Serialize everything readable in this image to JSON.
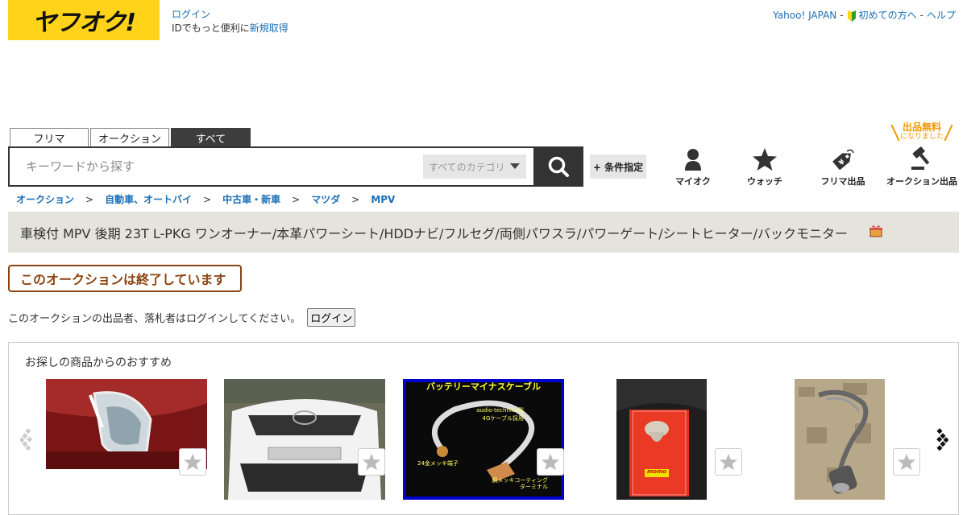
{
  "header": {
    "logo_text": "ヤフオク!",
    "login_label": "ログイン",
    "id_text": "IDでもっと便利に",
    "register_label": "新規取得",
    "yahoo_japan_label": "Yahoo! JAPAN",
    "first_time_label": "初めての方へ",
    "help_label": "ヘルプ",
    "separator": "-"
  },
  "search": {
    "tabs": [
      {
        "label": "フリマ"
      },
      {
        "label": "オークション"
      },
      {
        "label": "すべて"
      }
    ],
    "placeholder": "キーワードから探す",
    "category_label": "すべてのカテゴリ",
    "condition_label": "+ 条件指定"
  },
  "shortcuts": [
    {
      "label": "マイオク",
      "icon": "person-icon"
    },
    {
      "label": "ウォッチ",
      "icon": "star-icon"
    },
    {
      "label": "フリマ出品",
      "icon": "price-tag-icon"
    },
    {
      "label": "オークション出品",
      "icon": "gavel-icon"
    }
  ],
  "free_badge": {
    "main": "出品無料",
    "sub": "になりました"
  },
  "breadcrumb": [
    "オークション",
    "自動車、オートバイ",
    "中古車・新車",
    "マツダ",
    "MPV"
  ],
  "breadcrumb_sep": ">",
  "item": {
    "title": "車検付 MPV 後期 23T L-PKG ワンオーナー/本革パワーシート/HDDナビ/フルセグ/両側パワスラ/パワーゲート/シートヒーター/バックモニター"
  },
  "status": {
    "ended_label": "このオークションは終了しています",
    "login_message": "このオークションの出品者、落札者はログインしてください。",
    "login_button": "ログイン"
  },
  "recommend": {
    "heading": "お探しの商品からのおすすめ",
    "items": [
      {
        "name": "red-car-foglight-thumbnail"
      },
      {
        "name": "white-mpv-front-thumbnail"
      },
      {
        "name": "battery-cable-thumbnail",
        "caption": "バッテリーマイナスケーブル",
        "sub1": "audio-technica製",
        "sub2": "4Gケーブル採用",
        "sub3": "24金メッキ端子",
        "sub4": "銅メッキコーティング",
        "sub5": "ターミナル"
      },
      {
        "name": "shift-knob-box-thumbnail",
        "brand": "momo"
      },
      {
        "name": "exhaust-pipe-thumbnail"
      }
    ]
  },
  "colors": {
    "brand_yellow": "#ffd31a",
    "link_blue": "#1a6fb5",
    "ended_brown": "#8b4513",
    "free_orange": "#f39800"
  }
}
